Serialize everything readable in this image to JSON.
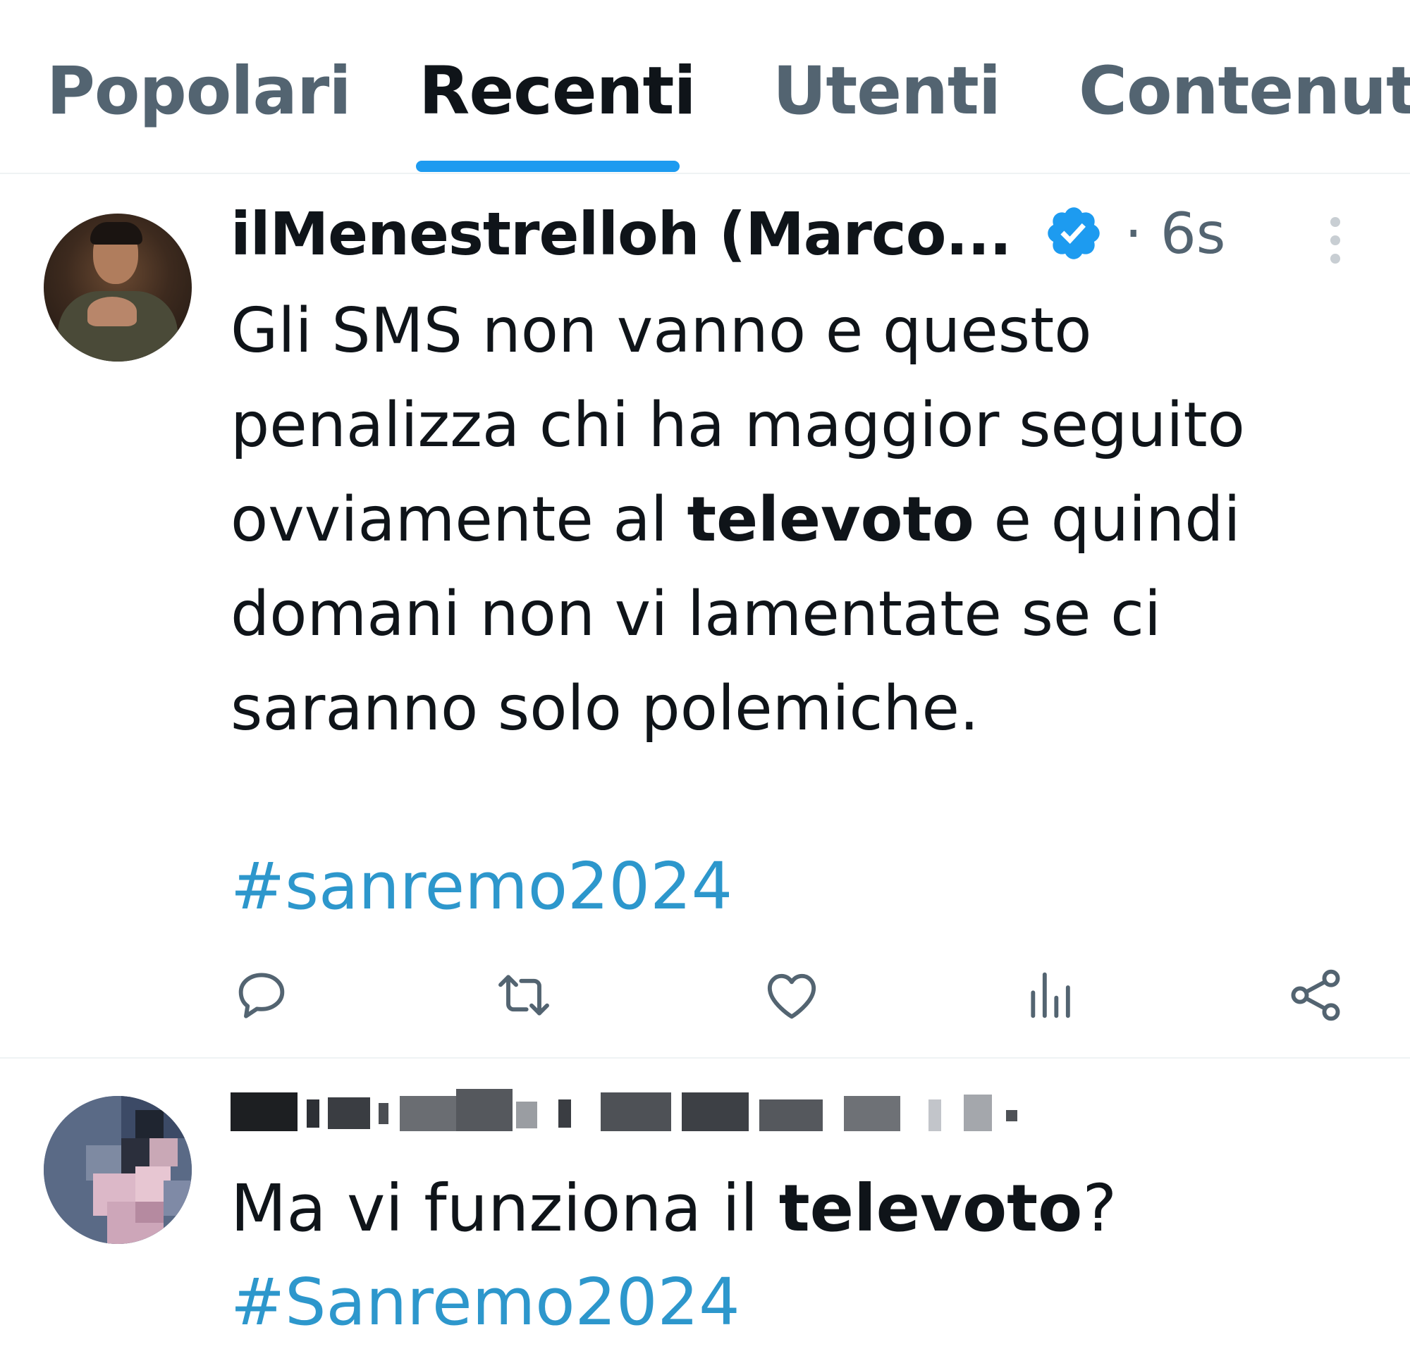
{
  "tabs": [
    {
      "label": "Popolari"
    },
    {
      "label": "Recenti",
      "active": true
    },
    {
      "label": "Utenti"
    },
    {
      "label": "Contenuti"
    }
  ],
  "tweet1": {
    "display_name": "ilMenestrelloh (Marco...",
    "time": "· 6s",
    "verified": true,
    "text_part1": "Gli SMS non vanno e questo",
    "text_part2": "penalizza chi ha maggior seguito",
    "text_part3a": "ovviamente al ",
    "text_bold": "televoto",
    "text_part3b": " e quindi",
    "text_part4": "domani non vi lamentate se ci",
    "text_part5": "saranno solo polemiche.",
    "hashtag": "#sanremo2024",
    "actions": [
      "reply-icon",
      "retweet-icon",
      "like-icon",
      "views-icon",
      "share-icon"
    ]
  },
  "tweet2": {
    "text_before": "Ma vi funziona il ",
    "text_bold": "televoto",
    "text_after": "?",
    "hashtag": "#Sanremo2024"
  },
  "colors": {
    "accent": "#1d9bf0",
    "hashtag": "#2d97cc",
    "muted": "#536471"
  }
}
